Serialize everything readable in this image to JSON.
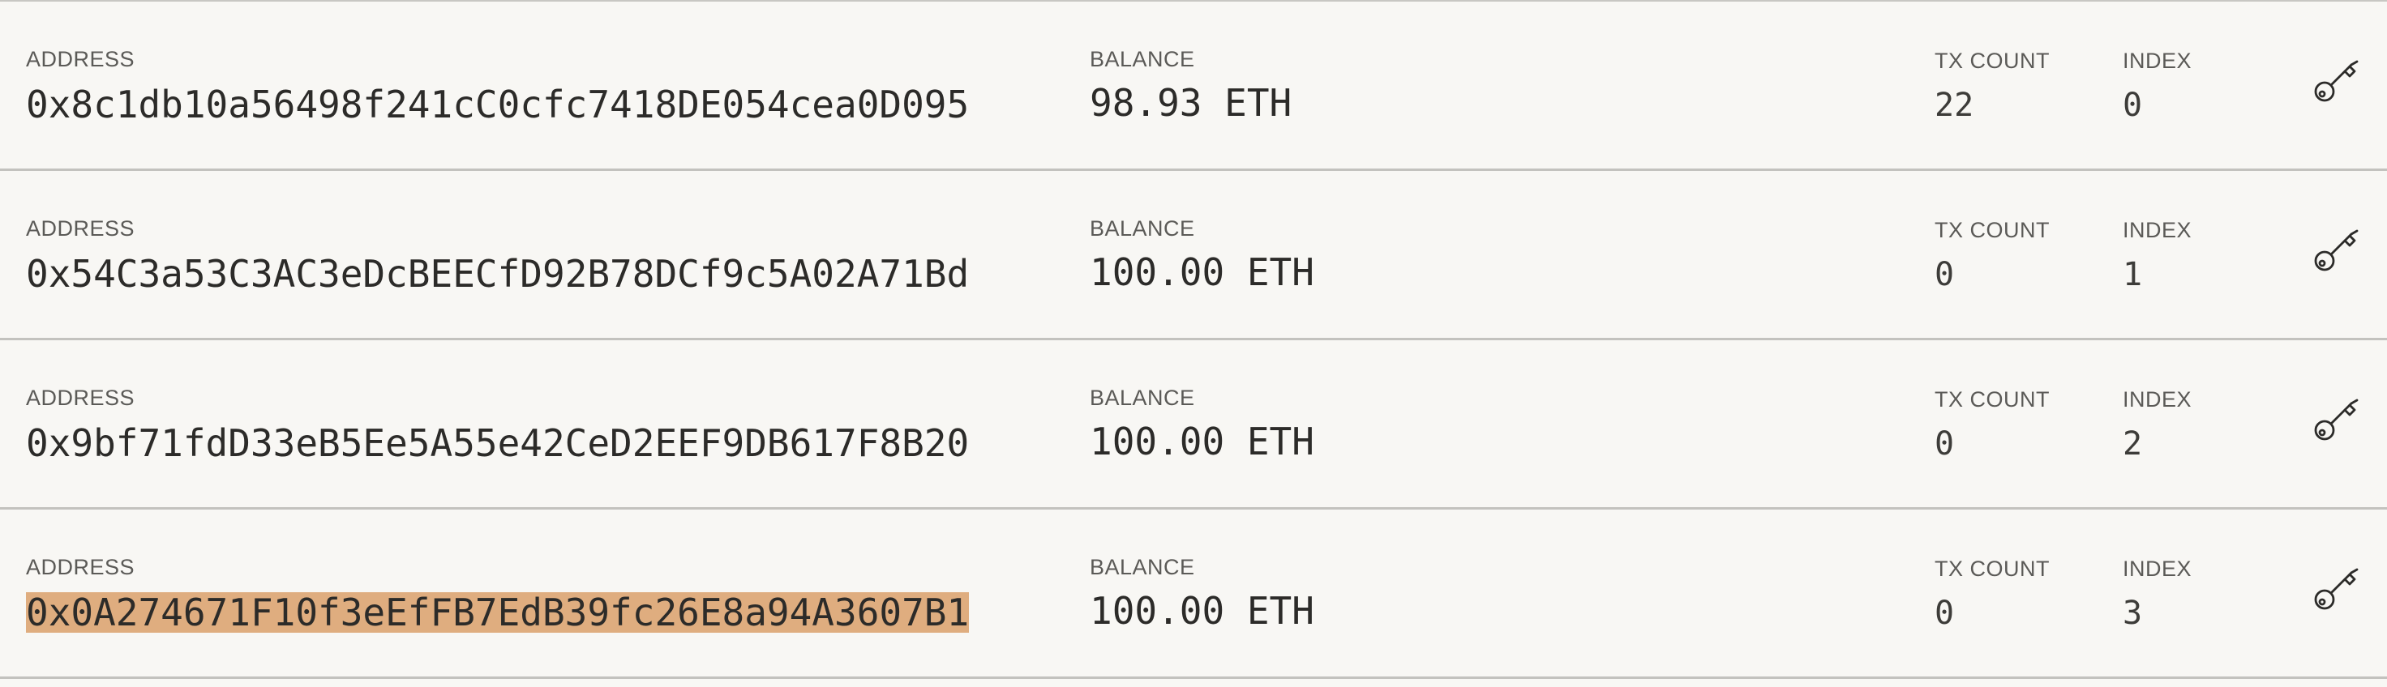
{
  "labels": {
    "address": "ADDRESS",
    "balance": "BALANCE",
    "tx_count": "TX COUNT",
    "index": "INDEX"
  },
  "accounts": [
    {
      "address": "0x8c1db10a56498f241cC0cfc7418DE054cea0D095",
      "balance": "98.93 ETH",
      "tx_count": "22",
      "index": "0",
      "selected": false
    },
    {
      "address": "0x54C3a53C3AC3eDcBEECfD92B78DCf9c5A02A71Bd",
      "balance": "100.00 ETH",
      "tx_count": "0",
      "index": "1",
      "selected": false
    },
    {
      "address": "0x9bf71fdD33eB5Ee5A55e42CeD2EEF9DB617F8B20",
      "balance": "100.00 ETH",
      "tx_count": "0",
      "index": "2",
      "selected": false
    },
    {
      "address": "0x0A274671F10f3eEfFB7EdB39fc26E8a94A3607B1",
      "balance": "100.00 ETH",
      "tx_count": "0",
      "index": "3",
      "selected": true
    }
  ],
  "icons": {
    "show_keys": "key-icon"
  },
  "colors": {
    "background": "#f8f7f4",
    "selection_highlight": "#dfad7f",
    "row_divider": "#c3c2be"
  }
}
